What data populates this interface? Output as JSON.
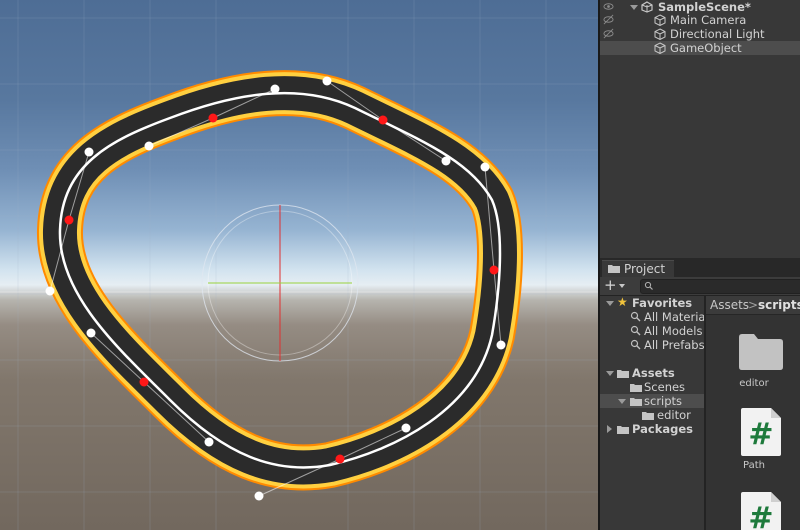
{
  "hierarchy": {
    "scene_name": "SampleScene*",
    "items": [
      {
        "label": "Main Camera"
      },
      {
        "label": "Directional Light"
      },
      {
        "label": "GameObject"
      }
    ]
  },
  "project": {
    "tab_label": "Project",
    "add_label": "+",
    "search_placeholder": "",
    "favorites": {
      "label": "Favorites",
      "items": [
        "All Materials",
        "All Models",
        "All Prefabs"
      ]
    },
    "assets_label": "Assets",
    "asset_children": [
      "Scenes",
      "scripts"
    ],
    "scripts_children": [
      "editor"
    ],
    "packages_label": "Packages",
    "breadcrumb": {
      "root": "Assets",
      "separator": ">",
      "current": "scripts"
    },
    "grid_items": [
      {
        "label": "editor",
        "icon": "folder-icon"
      },
      {
        "label": "Path",
        "icon": "csharp-script-icon",
        "glyph": "#"
      },
      {
        "label": "",
        "icon": "csharp-script-icon",
        "glyph": "#"
      }
    ]
  },
  "colors": {
    "track_border": "#f7a21b",
    "track_surface": "#2b2b2b",
    "centerline": "#ffffff",
    "anchor_point": "#ff2020",
    "control_point": "#ffffff",
    "selected_row": "#4d4d4d",
    "script_glyph": "#1e7a3c"
  }
}
